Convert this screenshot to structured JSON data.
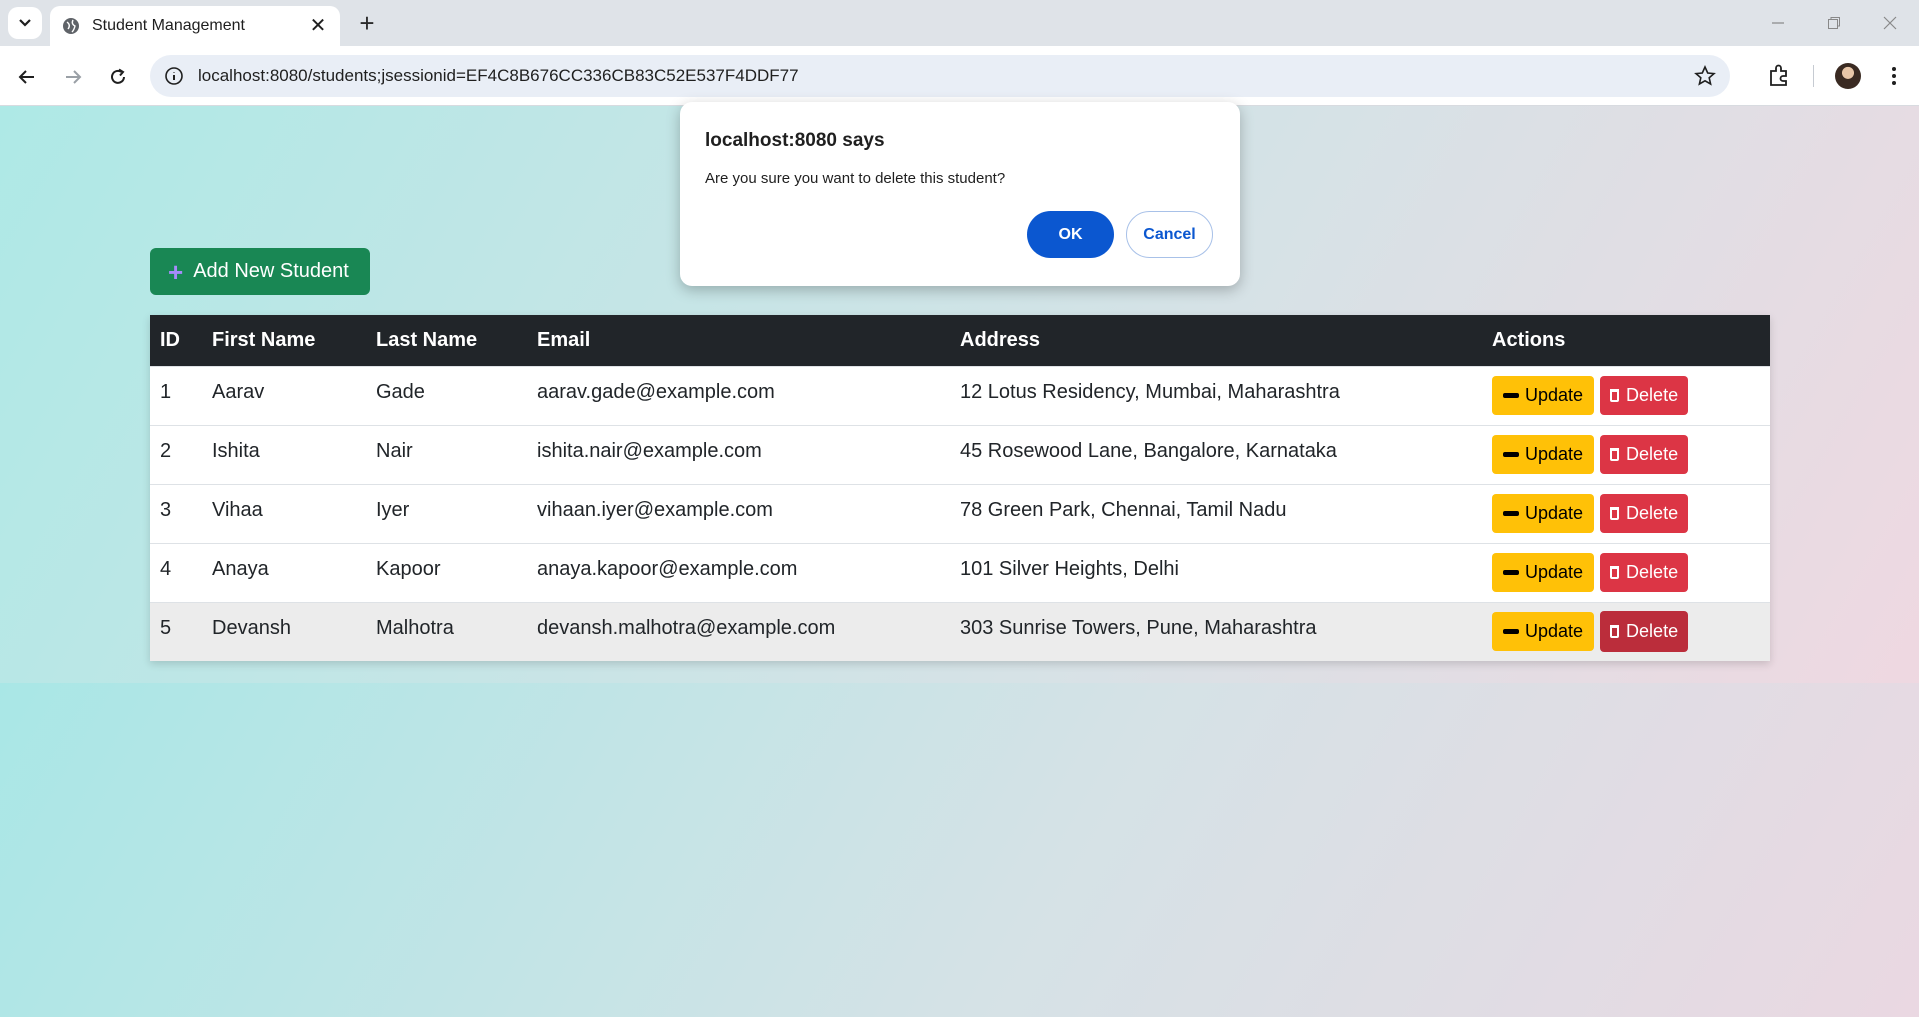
{
  "browser": {
    "tab_title": "Student Management",
    "url": "localhost:8080/students;jsessionid=EF4C8B676CC336CB83C52E537F4DDF77",
    "new_tab_label": "+",
    "tab_close_label": "✕"
  },
  "page": {
    "add_button_label": "Add New Student",
    "add_button_icon": "plus-icon",
    "table": {
      "headers": [
        "ID",
        "First Name",
        "Last Name",
        "Email",
        "Address",
        "Actions"
      ],
      "rows": [
        {
          "id": "1",
          "first": "Aarav",
          "last": "Gade",
          "email": "aarav.gade@example.com",
          "address": "12 Lotus Residency, Mumbai, Maharashtra"
        },
        {
          "id": "2",
          "first": "Ishita",
          "last": "Nair",
          "email": "ishita.nair@example.com",
          "address": "45 Rosewood Lane, Bangalore, Karnataka"
        },
        {
          "id": "3",
          "first": "Vihaa",
          "last": "Iyer",
          "email": "vihaan.iyer@example.com",
          "address": "78 Green Park, Chennai, Tamil Nadu"
        },
        {
          "id": "4",
          "first": "Anaya",
          "last": "Kapoor",
          "email": "anaya.kapoor@example.com",
          "address": "101 Silver Heights, Delhi"
        },
        {
          "id": "5",
          "first": "Devansh",
          "last": "Malhotra",
          "email": "devansh.malhotra@example.com",
          "address": "303 Sunrise Towers, Pune, Maharashtra"
        }
      ],
      "update_label": "Update",
      "delete_label": "Delete"
    }
  },
  "dialog": {
    "title": "localhost:8080 says",
    "message": "Are you sure you want to delete this student?",
    "ok_label": "OK",
    "cancel_label": "Cancel"
  },
  "colors": {
    "add_button": "#198754",
    "update_button": "#ffc107",
    "delete_button": "#dc3545",
    "table_header": "#212529",
    "dialog_ok": "#0b57d0"
  }
}
